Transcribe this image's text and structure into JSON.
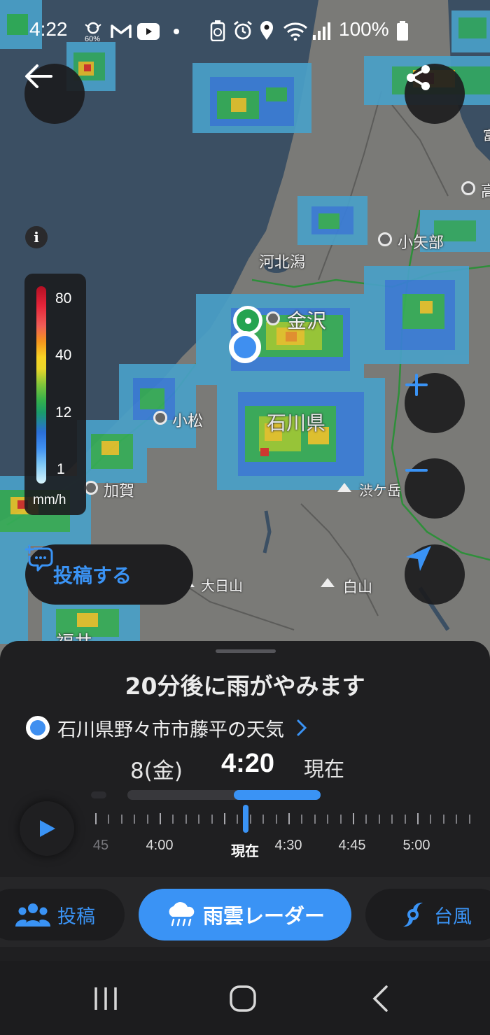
{
  "status_bar": {
    "time": "4:22",
    "data_saver_badge": "60%",
    "battery_percent": "100%",
    "icons": [
      "data-saver-icon",
      "gmail-icon",
      "youtube-icon",
      "dot-icon",
      "battery-saver-icon",
      "alarm-icon",
      "location-icon",
      "wifi-icon",
      "signal-icon",
      "battery-icon"
    ]
  },
  "map": {
    "labels": {
      "kahokugata": "河北潟",
      "kanazawa": "金沢",
      "komatsu": "小松",
      "kaga": "加賀",
      "ishikawa": "石川県",
      "oyabe": "小矢部",
      "takaoka_partial": "高",
      "shibu_partial": "富",
      "hakusan": "白山",
      "obamidake": "渋ケ岳",
      "dainichisan": "大日山",
      "fukui_partial": "福井"
    },
    "buttons": [
      "back-icon",
      "share-icon",
      "zoom-in-icon",
      "zoom-out-icon",
      "my-location-icon",
      "info-icon"
    ]
  },
  "legend": {
    "ticks": [
      "80",
      "40",
      "12",
      "1"
    ],
    "unit": "mm/h"
  },
  "post_button": {
    "label": "投稿する"
  },
  "sheet": {
    "headline": "20分後に雨がやみます",
    "location": "石川県野々市市藤平の天気",
    "date": "8(金)",
    "time": "4:20",
    "now": "現在",
    "progress_fraction": 0.45,
    "timeline_labels": {
      "l45": "45",
      "l400": "4:00",
      "now": "現在",
      "l430": "4:30",
      "l445": "4:45",
      "l500": "5:00"
    }
  },
  "tabs": {
    "posts": "投稿",
    "radar": "雨雲レーダー",
    "typhoon": "台風"
  },
  "colors": {
    "accent": "#3a93f5",
    "sea": "#3b4f63",
    "land": "#7b7b78",
    "sheet": "#1f1f21"
  }
}
